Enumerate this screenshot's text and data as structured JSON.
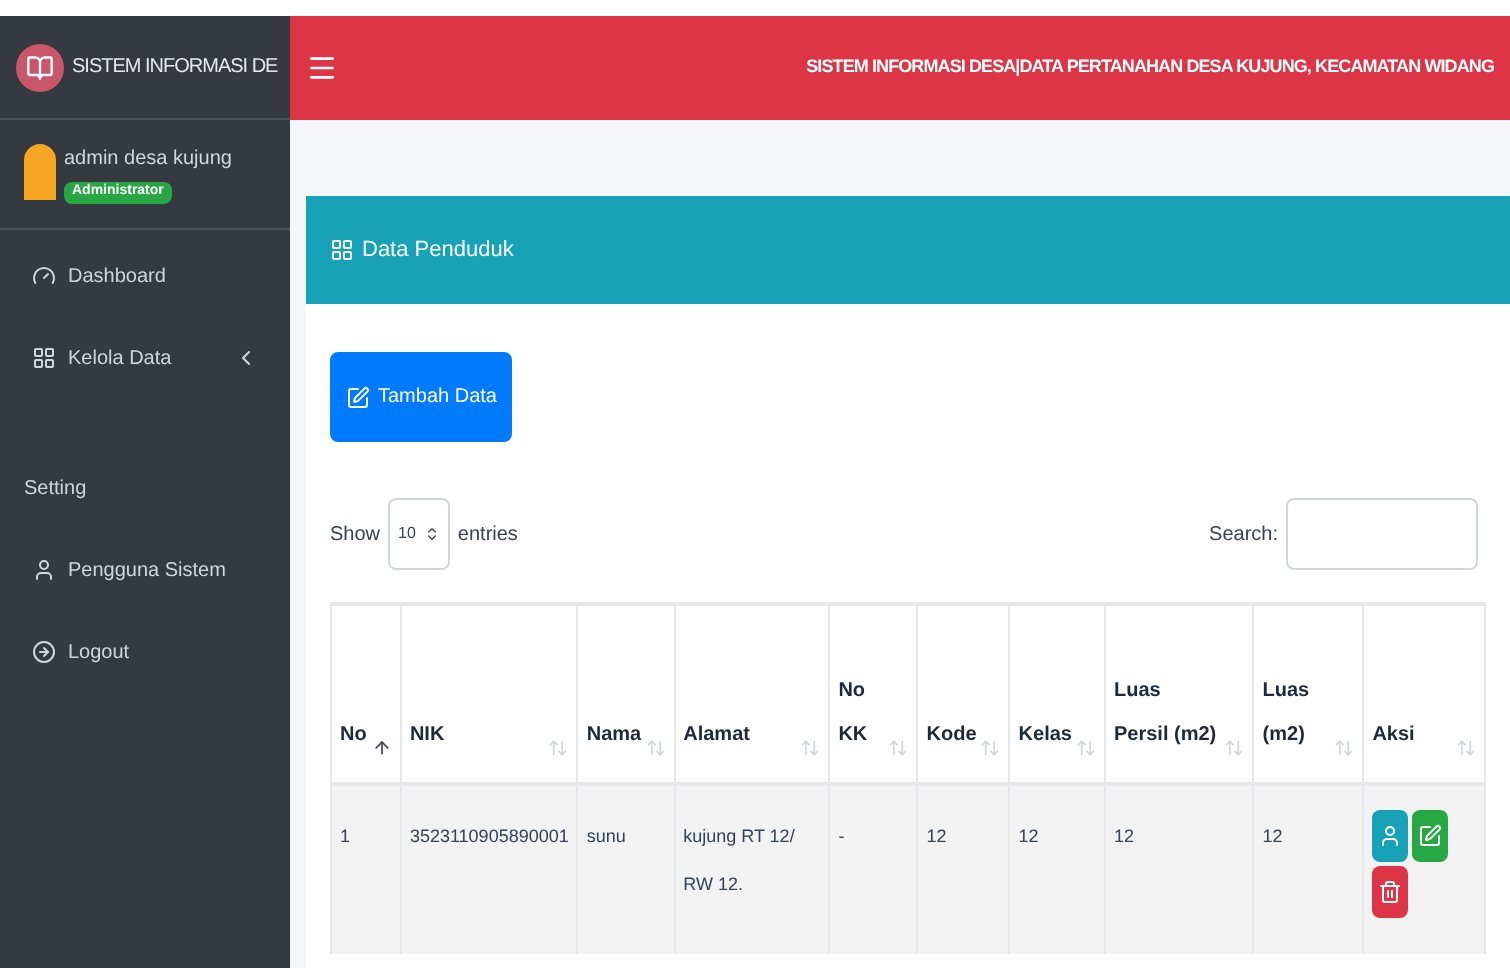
{
  "sidebar": {
    "brand": "SISTEM INFORMASI DE",
    "user": {
      "name": "admin desa kujung",
      "role": "Administrator"
    },
    "items": [
      {
        "kind": "link",
        "label": "Dashboard",
        "expandable": false
      },
      {
        "kind": "link",
        "label": "Kelola Data",
        "expandable": true
      },
      {
        "kind": "header",
        "label": "Setting"
      },
      {
        "kind": "link",
        "label": "Pengguna Sistem",
        "expandable": false
      },
      {
        "kind": "link",
        "label": "Logout",
        "expandable": false
      }
    ]
  },
  "header": {
    "title": "SISTEM INFORMASI DESA|DATA PERTANAHAN DESA KUJUNG, KECAMATAN WIDANG"
  },
  "card": {
    "title": "Data Penduduk",
    "add_button": "Tambah Data",
    "length": {
      "before": "Show",
      "value": "10",
      "after": "entries"
    },
    "search": {
      "label": "Search:"
    },
    "table": {
      "columns": [
        {
          "label": "No",
          "sorted": true
        },
        {
          "label": "NIK",
          "sorted": false
        },
        {
          "label": "Nama",
          "sorted": false
        },
        {
          "label": "Alamat",
          "sorted": false
        },
        {
          "label": "No KK",
          "sorted": false
        },
        {
          "label": "Kode",
          "sorted": false
        },
        {
          "label": "Kelas",
          "sorted": false
        },
        {
          "label": "Luas Persil (m2)",
          "sorted": false
        },
        {
          "label": "Luas (m2)",
          "sorted": false
        },
        {
          "label": "Aksi",
          "sorted": false
        }
      ],
      "rows": [
        {
          "cells": [
            "1",
            "3523110905890001",
            "sunu",
            "kujung RT 12/ RW 12.",
            "-",
            "12",
            "12",
            "12",
            "12"
          ],
          "actions": [
            {
              "kind": "view"
            },
            {
              "kind": "edit"
            },
            {
              "kind": "delete"
            }
          ]
        }
      ]
    }
  }
}
